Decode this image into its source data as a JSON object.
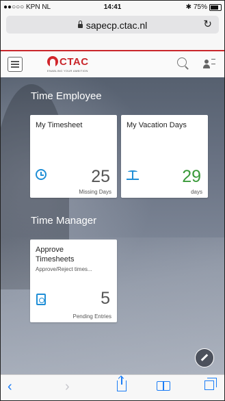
{
  "status_bar": {
    "carrier": "●●○○○ KPN NL",
    "time": "14:41",
    "battery": "75%"
  },
  "browser": {
    "url": "sapecp.ctac.nl"
  },
  "app": {
    "logo_text": "CTAC",
    "logo_tagline": "ENABLING YOUR AMBITION",
    "accent_color": "#c9262b"
  },
  "groups": [
    {
      "title": "Time Employee",
      "tiles": [
        {
          "title": "My Timesheet",
          "value": "25",
          "unit": "Missing Days",
          "icon": "clock-icon",
          "value_color": "#555555"
        },
        {
          "title": "My Vacation Days",
          "value": "29",
          "unit": "days",
          "icon": "vacation-icon",
          "value_color": "#3a9a3a"
        }
      ]
    },
    {
      "title": "Time Manager",
      "tiles": [
        {
          "title": "Approve Timesheets",
          "subtitle": "Approve/Reject times...",
          "value": "5",
          "unit": "Pending Entries",
          "icon": "approve-icon",
          "value_color": "#555555"
        }
      ]
    }
  ],
  "icons": {
    "edit": "pencil-icon",
    "icon_color": "#1f8ed6"
  }
}
